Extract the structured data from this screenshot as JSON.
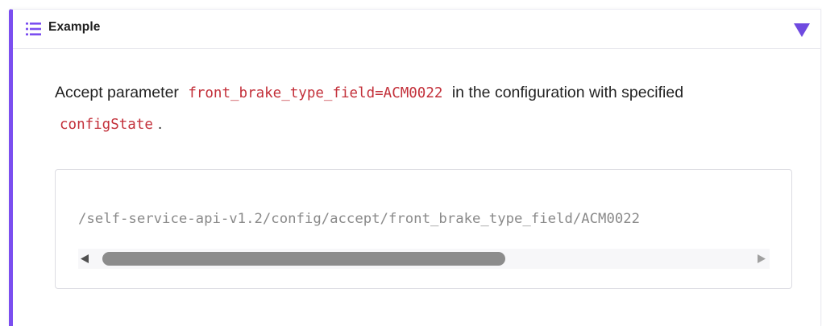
{
  "example": {
    "title": "Example",
    "icons": {
      "header": "numbered-list-icon",
      "toggle": "triangle-down-icon"
    },
    "colors": {
      "accent": "#7b4ef0",
      "code_text": "#c3303a",
      "code_block_text": "#8a8a8a"
    },
    "description": {
      "before": "Accept parameter",
      "param": "front_brake_type_field=ACM0022",
      "middle": "in the configuration with specified",
      "config": "configState",
      "after": "."
    },
    "code_block": {
      "line": "/self-service-api-v1.2/config/accept/front_brake_type_field/ACM0022"
    },
    "scrollbar": {
      "position_fraction": 0.0,
      "visible_fraction": 0.6
    }
  }
}
